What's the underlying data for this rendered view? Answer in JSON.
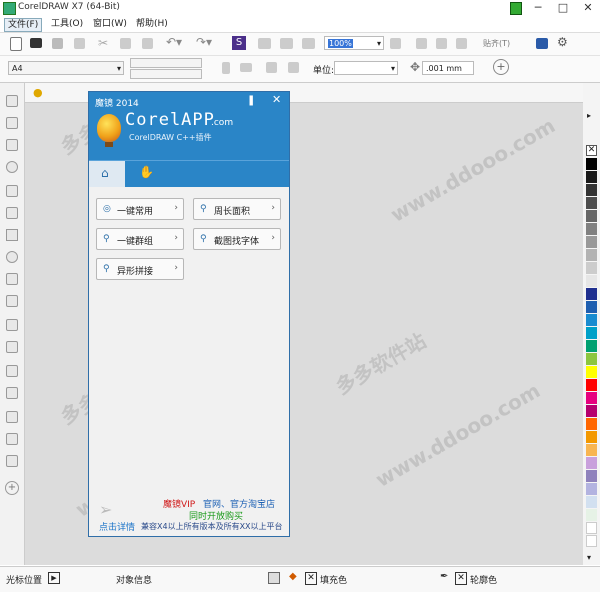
{
  "window": {
    "title": "CorelDRAW X7 (64-Bit)"
  },
  "menu": [
    "文件(F)",
    "工具(O)",
    "窗口(W)",
    "帮助(H)"
  ],
  "toolbar": {
    "zoom": "100%",
    "snap_label": "贴齐(T)"
  },
  "propbar": {
    "page_size": "A4",
    "units_label": "单位:",
    "nudge": ".001 mm"
  },
  "plugin": {
    "title": "魔镜 2014",
    "logo_text": "CorelAPP",
    "logo_suffix": ".com",
    "subtitle": "CorelDRAW C++插件",
    "buttons": [
      "一键常用",
      "周长面积",
      "一键群组",
      "截图找字体",
      "异形拼接"
    ],
    "footer_link": "点击详情",
    "promo_vip": "魔镜VIP",
    "promo_store": "官网、官方淘宝店",
    "promo_open": "同时开放购买",
    "promo_compat": "兼容X4以上所有版本及所有XX以上平台"
  },
  "statusbar": {
    "cursor_label": "光标位置",
    "object_label": "对象信息",
    "fill_label": "填充色",
    "outline_label": "轮廓色"
  },
  "watermark": {
    "text1": "多多软件站",
    "text2": "www.ddooo.com"
  },
  "palette_colors": [
    "#000000",
    "#1a1a1a",
    "#333333",
    "#4d4d4d",
    "#666666",
    "#808080",
    "#999999",
    "#b3b3b3",
    "#cccccc",
    "#e6e6e6",
    "#1f2f8f",
    "#1f5fb0",
    "#1a8cd0",
    "#00a0c8",
    "#00a070",
    "#8cc63f",
    "#ffff00",
    "#ff0000",
    "#e6007e",
    "#b5006e",
    "#ff6600",
    "#f39800",
    "#f8b551",
    "#c9a0dc",
    "#8f82bc",
    "#b3b3e0",
    "#d2e0f0",
    "#e6f2e6",
    "#ffffff",
    "#ffffff"
  ]
}
